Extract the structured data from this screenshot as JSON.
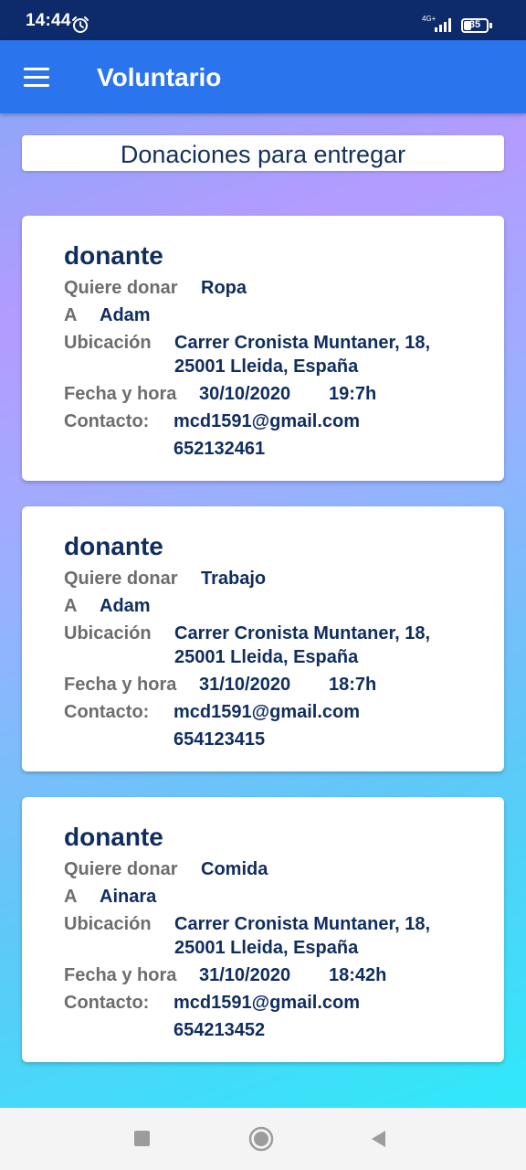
{
  "status_bar": {
    "time": "14:44",
    "network": "4G+",
    "battery": "35",
    "icons": [
      "alarm-icon",
      "signal-icon",
      "battery-icon"
    ]
  },
  "app_bar": {
    "title": "Voluntario",
    "menu_icon": "hamburger-menu-icon"
  },
  "section_title": "Donaciones para entregar",
  "labels": {
    "donate": "Quiere donar",
    "to": "A",
    "location": "Ubicación",
    "datetime": "Fecha y hora",
    "contact": "Contacto:"
  },
  "donations": [
    {
      "title": "donante",
      "item": "Ropa",
      "recipient": "Adam",
      "address_line1": "Carrer Cronista Muntaner, 18,",
      "address_line2": "25001 Lleida, España",
      "date": "30/10/2020",
      "time": "19:7h",
      "email": "mcd1591@gmail.com",
      "phone": "652132461"
    },
    {
      "title": "donante",
      "item": "Trabajo",
      "recipient": "Adam",
      "address_line1": "Carrer Cronista Muntaner, 18,",
      "address_line2": "25001 Lleida, España",
      "date": "31/10/2020",
      "time": "18:7h",
      "email": "mcd1591@gmail.com",
      "phone": "654123415"
    },
    {
      "title": "donante",
      "item": "Comida",
      "recipient": "Ainara",
      "address_line1": "Carrer Cronista Muntaner, 18,",
      "address_line2": "25001 Lleida, España",
      "date": "31/10/2020",
      "time": "18:42h",
      "email": "mcd1591@gmail.com",
      "phone": "654213452"
    }
  ],
  "nav_bar": {
    "icons": [
      "recents-square-icon",
      "home-circle-icon",
      "back-triangle-icon"
    ]
  },
  "colors": {
    "status_bar": "#0d2a6b",
    "app_bar": "#2a75ee",
    "text_primary": "#0f2d5f",
    "text_label": "#6d6d6d"
  }
}
